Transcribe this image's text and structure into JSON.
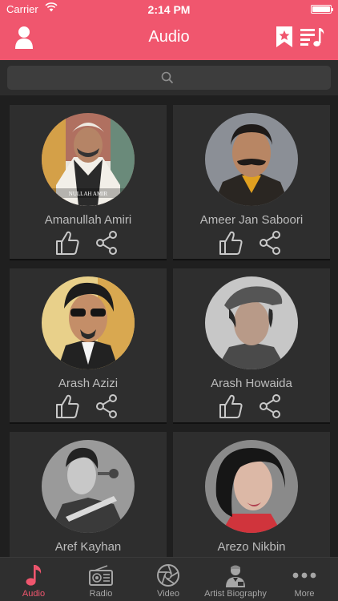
{
  "status_bar": {
    "carrier": "Carrier",
    "time": "2:14 PM"
  },
  "header": {
    "title": "Audio"
  },
  "search": {
    "placeholder": ""
  },
  "artists": [
    {
      "name": "Amanullah Amiri",
      "photo_caption": "NULLAH    AMIR"
    },
    {
      "name": "Ameer Jan Saboori"
    },
    {
      "name": "Arash Azizi"
    },
    {
      "name": "Arash Howaida"
    },
    {
      "name": "Aref Kayhan"
    },
    {
      "name": "Arezo Nikbin"
    }
  ],
  "tabs": [
    {
      "label": "Audio",
      "icon": "music-note-icon",
      "active": true
    },
    {
      "label": "Radio",
      "icon": "radio-icon",
      "active": false
    },
    {
      "label": "Video",
      "icon": "camera-aperture-icon",
      "active": false
    },
    {
      "label": "Artist Biography",
      "icon": "artist-biography-icon",
      "active": false
    },
    {
      "label": "More",
      "icon": "more-dots-icon",
      "active": false
    }
  ],
  "colors": {
    "accent": "#f0566e",
    "background": "#1f1f1f",
    "card": "#2e2e2e",
    "text_muted": "#bdbdbd",
    "tab_inactive": "#a6a6a6"
  }
}
